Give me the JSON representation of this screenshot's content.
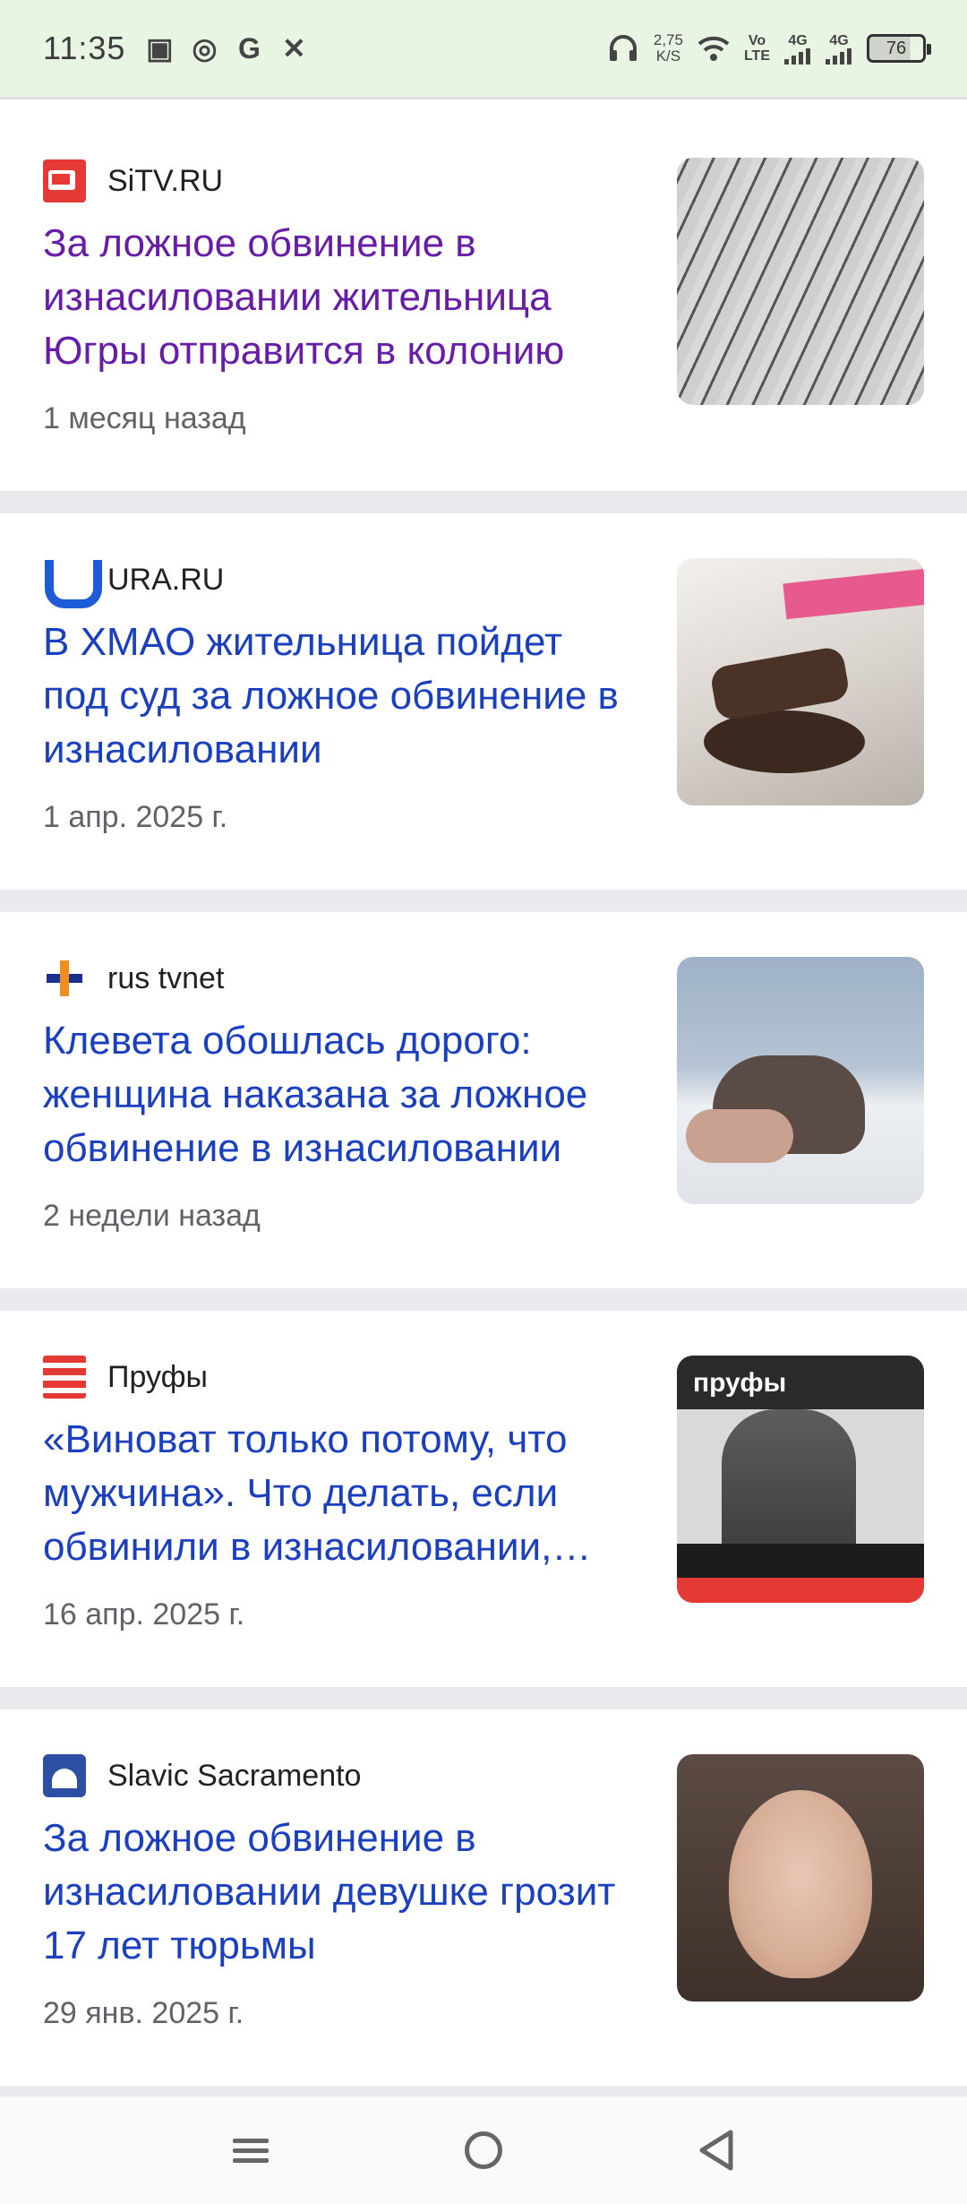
{
  "status_bar": {
    "time": "11:35",
    "speed_value": "2,75",
    "speed_unit": "K/S",
    "volte_top": "Vo",
    "volte_bottom": "LTE",
    "net1": "4G",
    "net2": "4G",
    "battery": "76"
  },
  "articles": [
    {
      "source": "SiTV.RU",
      "headline": "За ложное обвинение в изнасиловании жительница Югры отправится в колонию",
      "time": "1 месяц назад",
      "visited": true
    },
    {
      "source": "URA.RU",
      "headline": "В ХМАО жительница пойдет под суд за ложное обвинение в изнасиловании",
      "time": "1 апр. 2025 г.",
      "visited": false
    },
    {
      "source": "rus tvnet",
      "headline": "Клевета обошлась дорого: женщина наказана за ложное обвинение в изнасиловании",
      "time": "2 недели назад",
      "visited": false
    },
    {
      "source": "Пруфы",
      "headline": "«Виноват только потому, что мужчина». Что делать, если обвинили в изнасиловании, которого не было",
      "time": "16 апр. 2025 г.",
      "visited": false,
      "thumb_text": "пруфы"
    },
    {
      "source": "Slavic Sacramento",
      "headline": "За ложное обвинение в изнасиловании девушке грозит 17 лет тюрьмы",
      "time": "29 янв. 2025 г.",
      "visited": false
    }
  ],
  "colors": {
    "headline": "#1a3fbf",
    "headline_visited": "#681da8",
    "status_bar_bg": "#e8f5e3"
  }
}
